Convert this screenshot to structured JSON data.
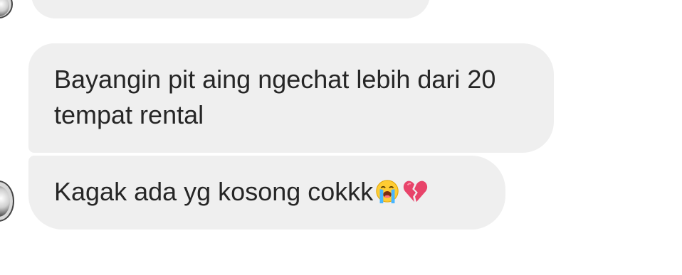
{
  "messages": [
    {
      "text": "Bayangin pit aing ngechat lebih dari 20 tempat rental"
    },
    {
      "text": "Kagak ada yg kosong cokkk"
    }
  ],
  "emojis": [
    "loudly-crying-face-icon",
    "broken-heart-icon"
  ],
  "colors": {
    "bubble_bg": "#efefef",
    "text": "#262626",
    "background": "#ffffff"
  }
}
